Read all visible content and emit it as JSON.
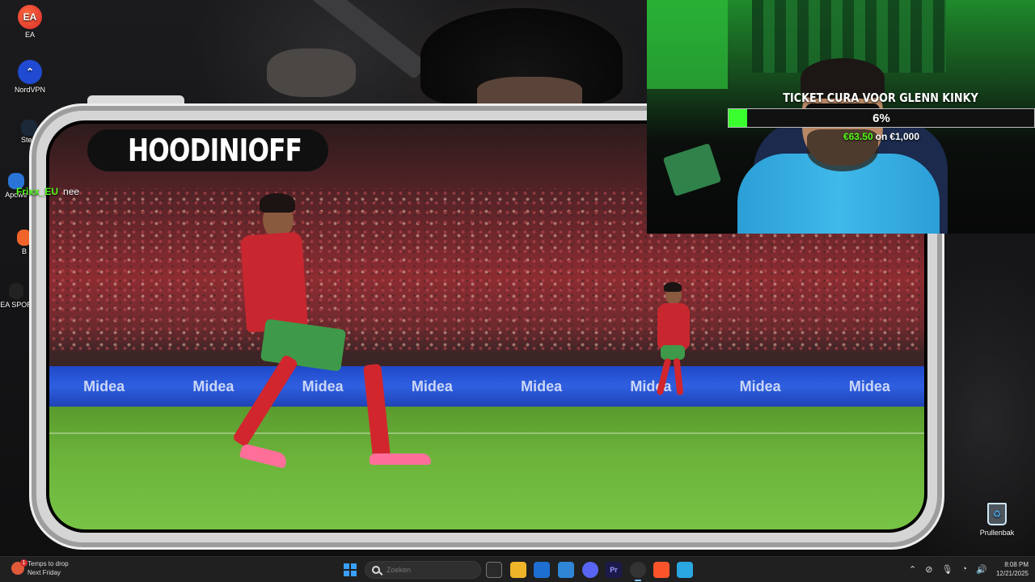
{
  "desktop": {
    "icons": [
      {
        "label": "EA",
        "glyph": "EA"
      },
      {
        "label": "NordVPN",
        "glyph": "⌃"
      },
      {
        "label": "Steam",
        "glyph": ""
      },
      {
        "label": "Apowe",
        "glyph": ""
      },
      {
        "label": "B",
        "glyph": ""
      },
      {
        "label": "EA SPOR",
        "glyph": ""
      }
    ],
    "recycle_bin": "Prullenbak"
  },
  "stream": {
    "channel_name": "HOODINIOFF",
    "chat": [
      {
        "user": "Frixx_EU",
        "message": "nee"
      }
    ],
    "ad_board_text": [
      "Midea",
      "Midea",
      "Midea",
      "Midea",
      "Midea",
      "Midea",
      "Midea",
      "Midea"
    ]
  },
  "goal": {
    "title": "TICKET CURA VOOR GLENN KINKY",
    "percent_label": "6%",
    "progress_fraction": 0.06,
    "current": "€63.50",
    "separator": "on",
    "target": "€1,000",
    "bar_color": "#39ff2f"
  },
  "taskbar": {
    "weather_line1": "Temps to drop",
    "weather_line2": "Next Friday",
    "weather_badge": "1",
    "search_placeholder": "Zoeken",
    "clock_time": "8:08 PM",
    "clock_date": "12/21/2025",
    "tray_icons": [
      "chevron-up-icon",
      "network-off-icon",
      "microphone-icon",
      "wifi-icon",
      "speaker-icon"
    ]
  }
}
